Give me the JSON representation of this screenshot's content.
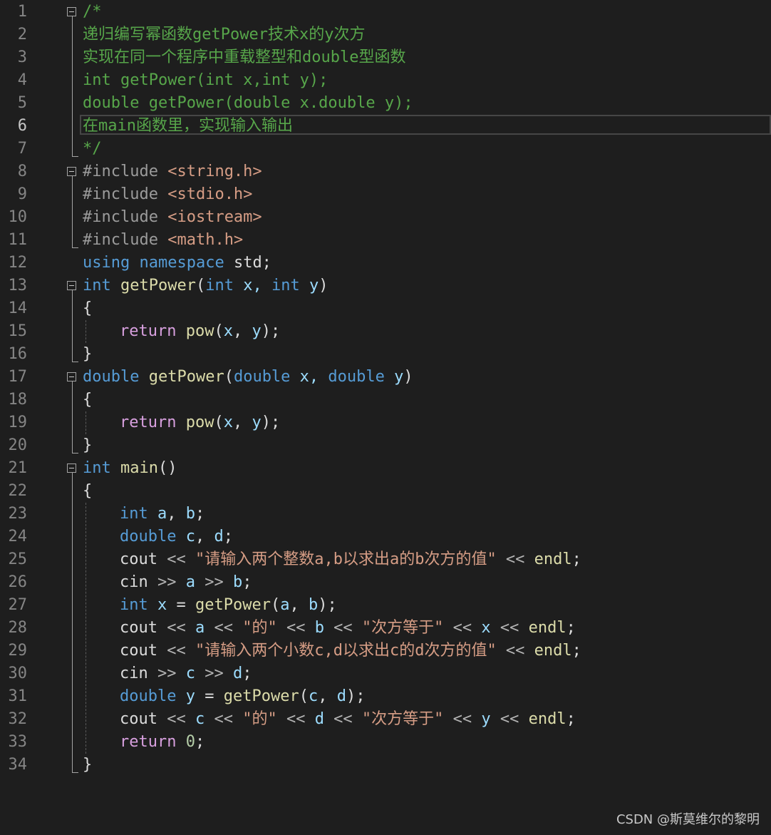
{
  "colors": {
    "comment": "#57a64a",
    "keyword": "#569cd6",
    "control": "#d8a0df",
    "function": "#dcdcaa",
    "variable": "#9cdcfe",
    "plain": "#dcdcdc",
    "string": "#d69d85",
    "preprocessor": "#9b9b9b",
    "number": "#b5cea8",
    "operator": "#b4b4b4",
    "line_number": "#858585"
  },
  "editor": {
    "active_line": 6,
    "lines": [
      {
        "num": "1",
        "indent": 0,
        "tokens": [
          {
            "t": "/*",
            "c": "comment"
          }
        ]
      },
      {
        "num": "2",
        "indent": 0,
        "tokens": [
          {
            "t": "递归编写幂函数getPower技术x的y次方",
            "c": "comment"
          }
        ]
      },
      {
        "num": "3",
        "indent": 0,
        "tokens": [
          {
            "t": "实现在同一个程序中重载整型和double型函数",
            "c": "comment"
          }
        ]
      },
      {
        "num": "4",
        "indent": 0,
        "tokens": [
          {
            "t": "int getPower(int x,int y);",
            "c": "comment"
          }
        ]
      },
      {
        "num": "5",
        "indent": 0,
        "tokens": [
          {
            "t": "double getPower(double x.double y);",
            "c": "comment"
          }
        ]
      },
      {
        "num": "6",
        "indent": 0,
        "tokens": [
          {
            "t": "在main函数里，实现输入输出",
            "c": "comment"
          }
        ]
      },
      {
        "num": "7",
        "indent": 0,
        "tokens": [
          {
            "t": "*/",
            "c": "comment"
          }
        ]
      },
      {
        "num": "8",
        "indent": 0,
        "tokens": [
          {
            "t": "#include ",
            "c": "preprocessor"
          },
          {
            "t": "<string.h>",
            "c": "string"
          }
        ]
      },
      {
        "num": "9",
        "indent": 0,
        "tokens": [
          {
            "t": "#include ",
            "c": "preprocessor"
          },
          {
            "t": "<stdio.h>",
            "c": "string"
          }
        ]
      },
      {
        "num": "10",
        "indent": 0,
        "tokens": [
          {
            "t": "#include ",
            "c": "preprocessor"
          },
          {
            "t": "<iostream>",
            "c": "string"
          }
        ]
      },
      {
        "num": "11",
        "indent": 0,
        "tokens": [
          {
            "t": "#include ",
            "c": "preprocessor"
          },
          {
            "t": "<math.h>",
            "c": "string"
          }
        ]
      },
      {
        "num": "12",
        "indent": 0,
        "tokens": [
          {
            "t": "using",
            "c": "keyword"
          },
          {
            "t": " ",
            "c": "plain"
          },
          {
            "t": "namespace",
            "c": "keyword"
          },
          {
            "t": " std;",
            "c": "plain"
          }
        ]
      },
      {
        "num": "13",
        "indent": 0,
        "tokens": [
          {
            "t": "int",
            "c": "keyword"
          },
          {
            "t": " ",
            "c": "plain"
          },
          {
            "t": "getPower",
            "c": "function"
          },
          {
            "t": "(",
            "c": "plain"
          },
          {
            "t": "int",
            "c": "keyword"
          },
          {
            "t": " x, ",
            "c": "variable"
          },
          {
            "t": "int",
            "c": "keyword"
          },
          {
            "t": " y",
            "c": "variable"
          },
          {
            "t": ")",
            "c": "plain"
          }
        ]
      },
      {
        "num": "14",
        "indent": 0,
        "tokens": [
          {
            "t": "{",
            "c": "plain"
          }
        ]
      },
      {
        "num": "15",
        "indent": 1,
        "tokens": [
          {
            "t": "return",
            "c": "control"
          },
          {
            "t": " ",
            "c": "plain"
          },
          {
            "t": "pow",
            "c": "function"
          },
          {
            "t": "(",
            "c": "plain"
          },
          {
            "t": "x",
            "c": "variable"
          },
          {
            "t": ", ",
            "c": "plain"
          },
          {
            "t": "y",
            "c": "variable"
          },
          {
            "t": ");",
            "c": "plain"
          }
        ]
      },
      {
        "num": "16",
        "indent": 0,
        "tokens": [
          {
            "t": "}",
            "c": "plain"
          }
        ]
      },
      {
        "num": "17",
        "indent": 0,
        "tokens": [
          {
            "t": "double",
            "c": "keyword"
          },
          {
            "t": " ",
            "c": "plain"
          },
          {
            "t": "getPower",
            "c": "function"
          },
          {
            "t": "(",
            "c": "plain"
          },
          {
            "t": "double",
            "c": "keyword"
          },
          {
            "t": " x, ",
            "c": "variable"
          },
          {
            "t": "double",
            "c": "keyword"
          },
          {
            "t": " y",
            "c": "variable"
          },
          {
            "t": ")",
            "c": "plain"
          }
        ]
      },
      {
        "num": "18",
        "indent": 0,
        "tokens": [
          {
            "t": "{",
            "c": "plain"
          }
        ]
      },
      {
        "num": "19",
        "indent": 1,
        "tokens": [
          {
            "t": "return",
            "c": "control"
          },
          {
            "t": " ",
            "c": "plain"
          },
          {
            "t": "pow",
            "c": "function"
          },
          {
            "t": "(",
            "c": "plain"
          },
          {
            "t": "x",
            "c": "variable"
          },
          {
            "t": ", ",
            "c": "plain"
          },
          {
            "t": "y",
            "c": "variable"
          },
          {
            "t": ");",
            "c": "plain"
          }
        ]
      },
      {
        "num": "20",
        "indent": 0,
        "tokens": [
          {
            "t": "}",
            "c": "plain"
          }
        ]
      },
      {
        "num": "21",
        "indent": 0,
        "tokens": [
          {
            "t": "int",
            "c": "keyword"
          },
          {
            "t": " ",
            "c": "plain"
          },
          {
            "t": "main",
            "c": "function"
          },
          {
            "t": "()",
            "c": "plain"
          }
        ]
      },
      {
        "num": "22",
        "indent": 0,
        "tokens": [
          {
            "t": "{",
            "c": "plain"
          }
        ]
      },
      {
        "num": "23",
        "indent": 1,
        "tokens": [
          {
            "t": "int",
            "c": "keyword"
          },
          {
            "t": " ",
            "c": "plain"
          },
          {
            "t": "a",
            "c": "variable"
          },
          {
            "t": ", ",
            "c": "plain"
          },
          {
            "t": "b",
            "c": "variable"
          },
          {
            "t": ";",
            "c": "plain"
          }
        ]
      },
      {
        "num": "24",
        "indent": 1,
        "tokens": [
          {
            "t": "double",
            "c": "keyword"
          },
          {
            "t": " ",
            "c": "plain"
          },
          {
            "t": "c",
            "c": "variable"
          },
          {
            "t": ", ",
            "c": "plain"
          },
          {
            "t": "d",
            "c": "variable"
          },
          {
            "t": ";",
            "c": "plain"
          }
        ]
      },
      {
        "num": "25",
        "indent": 1,
        "tokens": [
          {
            "t": "cout",
            "c": "plain"
          },
          {
            "t": " << ",
            "c": "operator"
          },
          {
            "t": "\"请输入两个整数a,b以求出a的b次方的值\"",
            "c": "string"
          },
          {
            "t": " << ",
            "c": "operator"
          },
          {
            "t": "endl",
            "c": "function"
          },
          {
            "t": ";",
            "c": "plain"
          }
        ]
      },
      {
        "num": "26",
        "indent": 1,
        "tokens": [
          {
            "t": "cin",
            "c": "plain"
          },
          {
            "t": " >> ",
            "c": "operator"
          },
          {
            "t": "a",
            "c": "variable"
          },
          {
            "t": " >> ",
            "c": "operator"
          },
          {
            "t": "b",
            "c": "variable"
          },
          {
            "t": ";",
            "c": "plain"
          }
        ]
      },
      {
        "num": "27",
        "indent": 1,
        "tokens": [
          {
            "t": "int",
            "c": "keyword"
          },
          {
            "t": " ",
            "c": "plain"
          },
          {
            "t": "x",
            "c": "variable"
          },
          {
            "t": " = ",
            "c": "plain"
          },
          {
            "t": "getPower",
            "c": "function"
          },
          {
            "t": "(",
            "c": "plain"
          },
          {
            "t": "a",
            "c": "variable"
          },
          {
            "t": ", ",
            "c": "plain"
          },
          {
            "t": "b",
            "c": "variable"
          },
          {
            "t": ");",
            "c": "plain"
          }
        ]
      },
      {
        "num": "28",
        "indent": 1,
        "tokens": [
          {
            "t": "cout",
            "c": "plain"
          },
          {
            "t": " << ",
            "c": "operator"
          },
          {
            "t": "a",
            "c": "variable"
          },
          {
            "t": " << ",
            "c": "operator"
          },
          {
            "t": "\"的\"",
            "c": "string"
          },
          {
            "t": " << ",
            "c": "operator"
          },
          {
            "t": "b",
            "c": "variable"
          },
          {
            "t": " << ",
            "c": "operator"
          },
          {
            "t": "\"次方等于\"",
            "c": "string"
          },
          {
            "t": " << ",
            "c": "operator"
          },
          {
            "t": "x",
            "c": "variable"
          },
          {
            "t": " << ",
            "c": "operator"
          },
          {
            "t": "endl",
            "c": "function"
          },
          {
            "t": ";",
            "c": "plain"
          }
        ]
      },
      {
        "num": "29",
        "indent": 1,
        "tokens": [
          {
            "t": "cout",
            "c": "plain"
          },
          {
            "t": " << ",
            "c": "operator"
          },
          {
            "t": "\"请输入两个小数c,d以求出c的d次方的值\"",
            "c": "string"
          },
          {
            "t": " << ",
            "c": "operator"
          },
          {
            "t": "endl",
            "c": "function"
          },
          {
            "t": ";",
            "c": "plain"
          }
        ]
      },
      {
        "num": "30",
        "indent": 1,
        "tokens": [
          {
            "t": "cin",
            "c": "plain"
          },
          {
            "t": " >> ",
            "c": "operator"
          },
          {
            "t": "c",
            "c": "variable"
          },
          {
            "t": " >> ",
            "c": "operator"
          },
          {
            "t": "d",
            "c": "variable"
          },
          {
            "t": ";",
            "c": "plain"
          }
        ]
      },
      {
        "num": "31",
        "indent": 1,
        "tokens": [
          {
            "t": "double",
            "c": "keyword"
          },
          {
            "t": " ",
            "c": "plain"
          },
          {
            "t": "y",
            "c": "variable"
          },
          {
            "t": " = ",
            "c": "plain"
          },
          {
            "t": "getPower",
            "c": "function"
          },
          {
            "t": "(",
            "c": "plain"
          },
          {
            "t": "c",
            "c": "variable"
          },
          {
            "t": ", ",
            "c": "plain"
          },
          {
            "t": "d",
            "c": "variable"
          },
          {
            "t": ");",
            "c": "plain"
          }
        ]
      },
      {
        "num": "32",
        "indent": 1,
        "tokens": [
          {
            "t": "cout",
            "c": "plain"
          },
          {
            "t": " << ",
            "c": "operator"
          },
          {
            "t": "c",
            "c": "variable"
          },
          {
            "t": " << ",
            "c": "operator"
          },
          {
            "t": "\"的\"",
            "c": "string"
          },
          {
            "t": " << ",
            "c": "operator"
          },
          {
            "t": "d",
            "c": "variable"
          },
          {
            "t": " << ",
            "c": "operator"
          },
          {
            "t": "\"次方等于\"",
            "c": "string"
          },
          {
            "t": " << ",
            "c": "operator"
          },
          {
            "t": "y",
            "c": "variable"
          },
          {
            "t": " << ",
            "c": "operator"
          },
          {
            "t": "endl",
            "c": "function"
          },
          {
            "t": ";",
            "c": "plain"
          }
        ]
      },
      {
        "num": "33",
        "indent": 1,
        "tokens": [
          {
            "t": "return",
            "c": "control"
          },
          {
            "t": " ",
            "c": "plain"
          },
          {
            "t": "0",
            "c": "number"
          },
          {
            "t": ";",
            "c": "plain"
          }
        ]
      },
      {
        "num": "34",
        "indent": 0,
        "tokens": [
          {
            "t": "}",
            "c": "plain"
          }
        ]
      }
    ]
  },
  "watermark": "CSDN @斯莫维尔的黎明"
}
